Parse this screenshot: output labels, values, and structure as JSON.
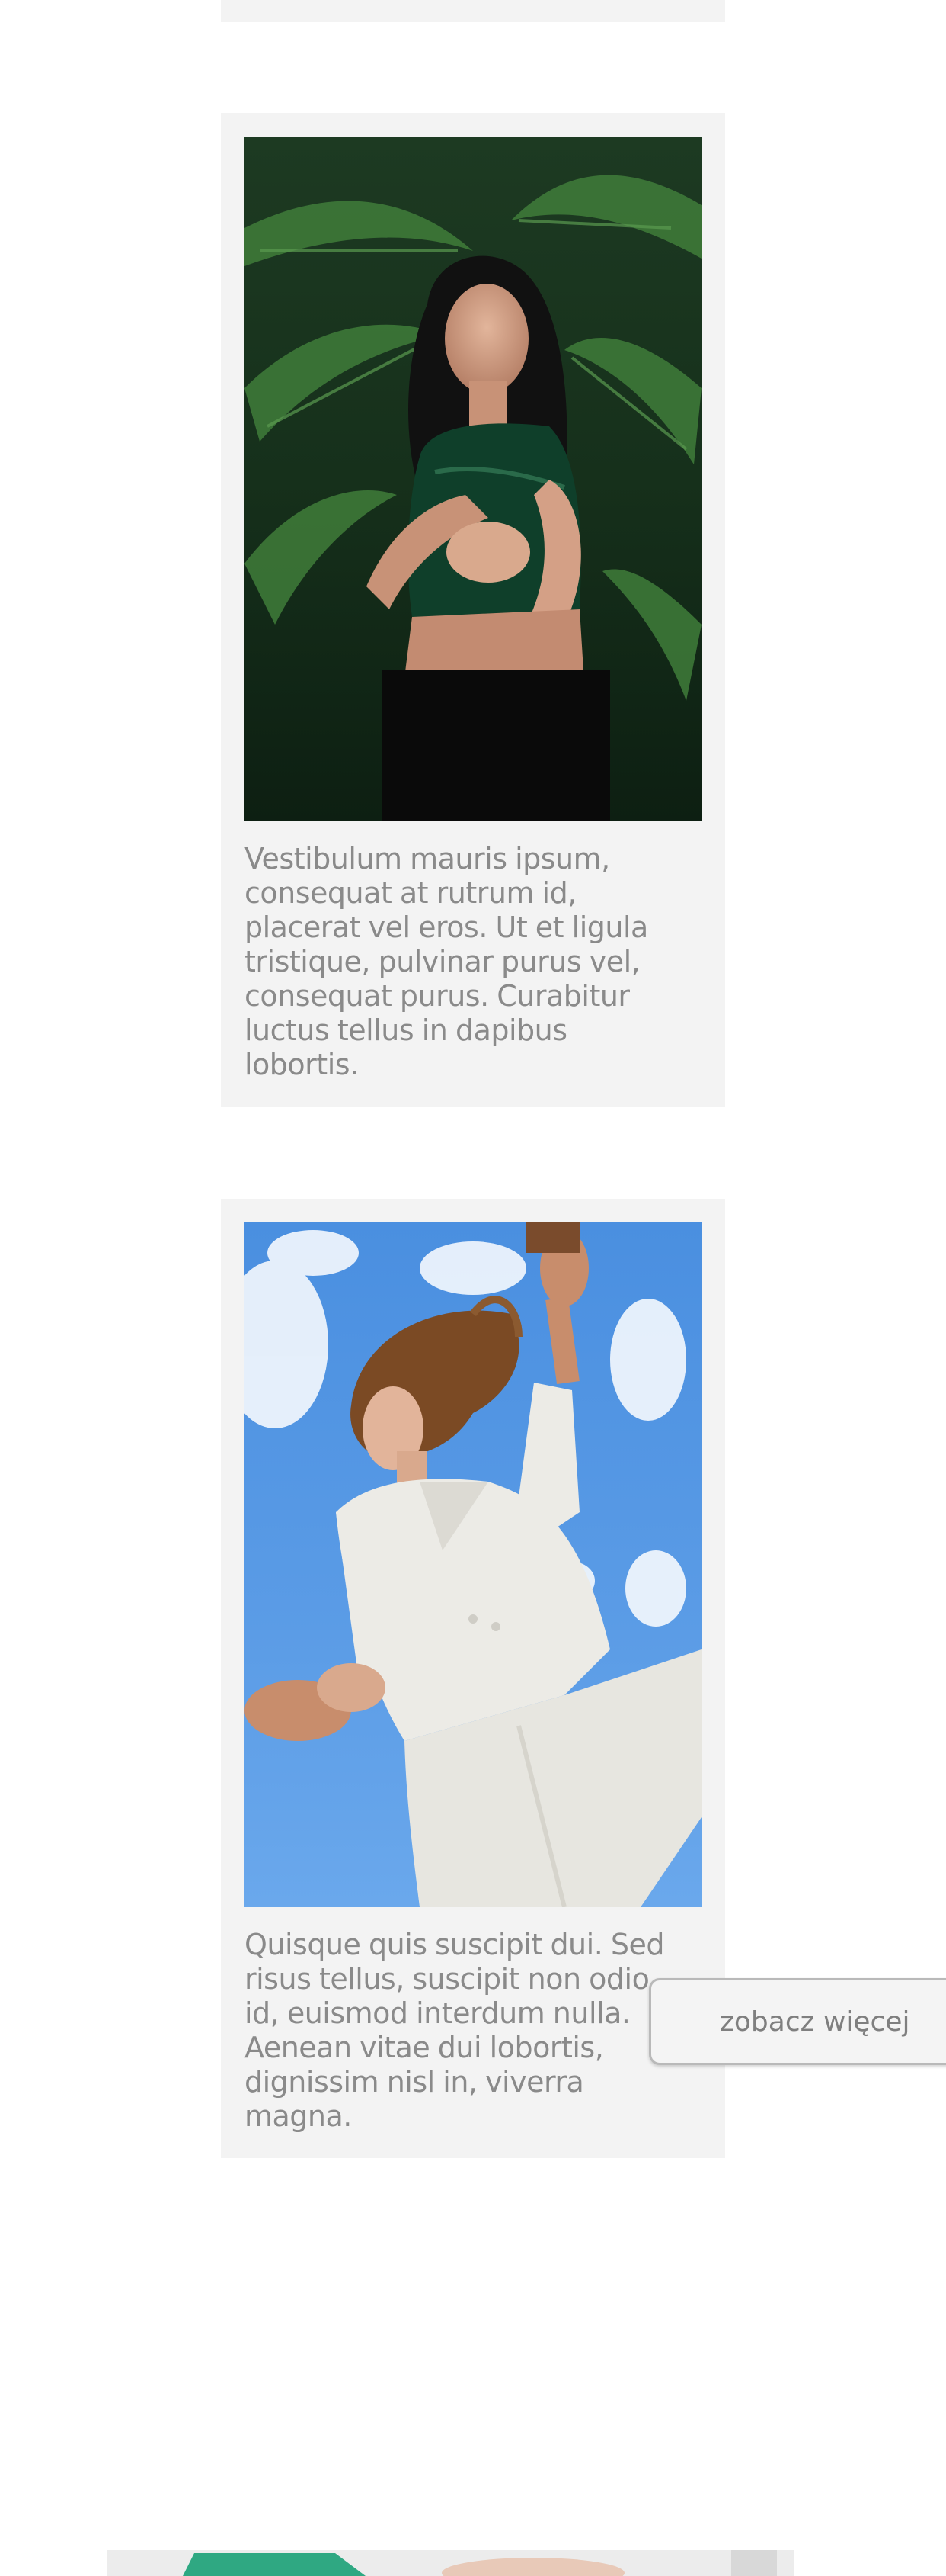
{
  "cards": [
    {
      "image_alt": "Woman in dark green satin top among palm leaves",
      "caption": "Vestibulum mauris ipsum, consequat at rutrum id, placerat vel eros. Ut et ligula tristique, pulvinar purus vel, consequat purus. Curabitur luctus tellus in dapibus lobortis."
    },
    {
      "image_alt": "Woman in white suit against blue sky, hair flying",
      "caption": "Quisque quis suscipit dui. Sed risus tellus, suscipit non odio id, euismod interdum nulla. Aenean vitae dui lobortis, dignissim nisl in, viverra magna."
    }
  ],
  "see_more": {
    "label": "zobacz więcej"
  },
  "colors": {
    "card_background": "#f3f3f3",
    "caption_text": "#8a8a8a",
    "button_background": "#f4f4f4",
    "button_border": "#b9b9b9",
    "button_text": "#7f7f7f"
  }
}
